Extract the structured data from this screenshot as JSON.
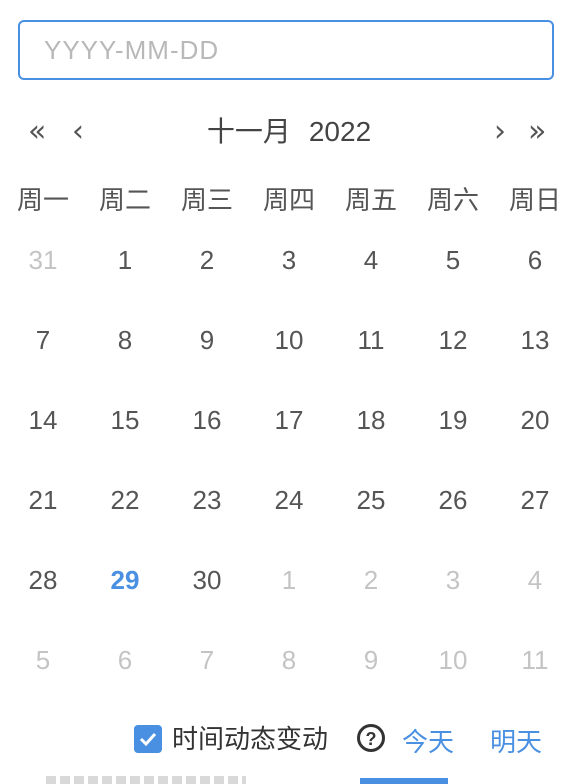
{
  "input": {
    "placeholder": "YYYY-MM-DD",
    "value": ""
  },
  "nav": {
    "prev_year": "«",
    "prev_month": "‹",
    "next_month": "›",
    "next_year": "»"
  },
  "header": {
    "month": "十一月",
    "year": "2022"
  },
  "weekdays": [
    "周一",
    "周二",
    "周三",
    "周四",
    "周五",
    "周六",
    "周日"
  ],
  "days": [
    {
      "label": "31",
      "muted": true
    },
    {
      "label": "1"
    },
    {
      "label": "2"
    },
    {
      "label": "3"
    },
    {
      "label": "4"
    },
    {
      "label": "5"
    },
    {
      "label": "6"
    },
    {
      "label": "7"
    },
    {
      "label": "8"
    },
    {
      "label": "9"
    },
    {
      "label": "10"
    },
    {
      "label": "11"
    },
    {
      "label": "12"
    },
    {
      "label": "13"
    },
    {
      "label": "14"
    },
    {
      "label": "15"
    },
    {
      "label": "16"
    },
    {
      "label": "17"
    },
    {
      "label": "18"
    },
    {
      "label": "19"
    },
    {
      "label": "20"
    },
    {
      "label": "21"
    },
    {
      "label": "22"
    },
    {
      "label": "23"
    },
    {
      "label": "24"
    },
    {
      "label": "25"
    },
    {
      "label": "26"
    },
    {
      "label": "27"
    },
    {
      "label": "28"
    },
    {
      "label": "29",
      "today": true
    },
    {
      "label": "30"
    },
    {
      "label": "1",
      "muted": true
    },
    {
      "label": "2",
      "muted": true
    },
    {
      "label": "3",
      "muted": true
    },
    {
      "label": "4",
      "muted": true
    },
    {
      "label": "5",
      "muted": true
    },
    {
      "label": "6",
      "muted": true
    },
    {
      "label": "7",
      "muted": true
    },
    {
      "label": "8",
      "muted": true
    },
    {
      "label": "9",
      "muted": true
    },
    {
      "label": "10",
      "muted": true
    },
    {
      "label": "11",
      "muted": true
    }
  ],
  "footer": {
    "checkbox_checked": true,
    "checkbox_label": "时间动态变动",
    "help_icon": "question-circle-icon",
    "help_glyph": "?",
    "today_label": "今天",
    "tomorrow_label": "明天"
  },
  "colors": {
    "accent": "#4a90e2",
    "muted": "#c4c4c4",
    "text": "#555555"
  }
}
